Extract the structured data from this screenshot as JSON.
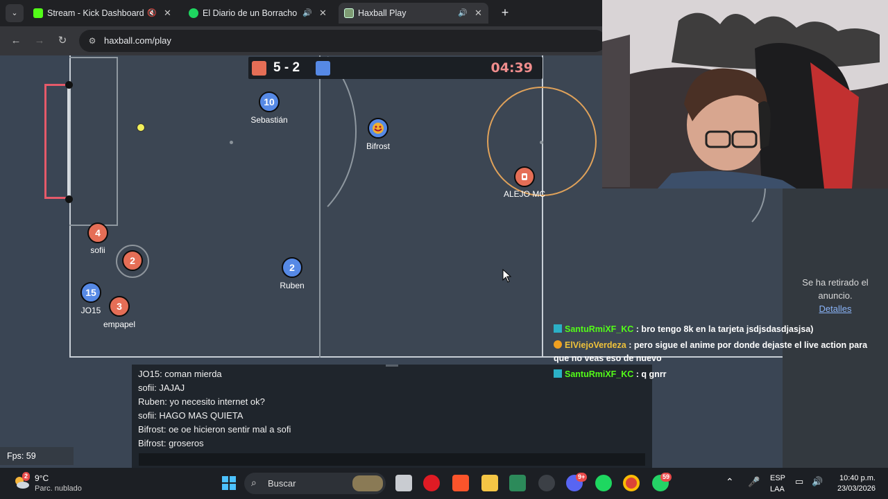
{
  "browser": {
    "tabs": [
      {
        "label": "Stream - Kick Dashboard"
      },
      {
        "label": "El Diario de un Borracho (El"
      },
      {
        "label": "Haxball Play"
      }
    ],
    "url": "haxball.com/play"
  },
  "game": {
    "score": "5 - 2",
    "timer": "04:39",
    "red_color": "#e56e56",
    "blue_color": "#5689e5",
    "players": [
      {
        "number": "10",
        "name": "Sebastián",
        "team": "blue"
      },
      {
        "number": "",
        "name": "Bifrost",
        "team": "blue"
      },
      {
        "number": "",
        "name": "ALEJO MC",
        "team": "red"
      },
      {
        "number": "4",
        "name": "sofii",
        "team": "red"
      },
      {
        "number": "2",
        "name": "",
        "team": "red"
      },
      {
        "number": "2",
        "name": "Ruben",
        "team": "blue"
      },
      {
        "number": "15",
        "name": "JO15",
        "team": "blue"
      },
      {
        "number": "3",
        "name": "empapel",
        "team": "red"
      }
    ],
    "chat": [
      "JO15: coman mierda",
      "sofii: JAJAJ",
      "Ruben: yo necesito internet ok?",
      "sofii: HAGO MAS QUIETA",
      "Bifrost: oe oe hicieron sentir mal a sofi",
      "Bifrost: groseros"
    ],
    "fps": "Fps: 59"
  },
  "ad": {
    "text": "Se ha retirado el anuncio.",
    "link": "Detalles"
  },
  "stream_chat": [
    {
      "user": "SantuRmiXF_KC",
      "message": " : bro tengo 8k en la tarjeta jsdjsdasdjasjsa)"
    },
    {
      "user": "ElViejoVerdeza",
      "message": " : pero sigue el anime por donde dejaste el live action para que no veas eso de nuevo"
    },
    {
      "user": "SantuRmiXF_KC",
      "message": " : q gnrr"
    }
  ],
  "taskbar": {
    "weather_temp": "9°C",
    "weather_desc": "Parc. nublado",
    "weather_badge": "2",
    "search_placeholder": "Buscar",
    "discord_badge": "9+",
    "whatsapp_badge": "59",
    "language": "ESP",
    "language_sub": "LAA",
    "time": "10:40 p.m.",
    "date": "23/03/2026"
  }
}
